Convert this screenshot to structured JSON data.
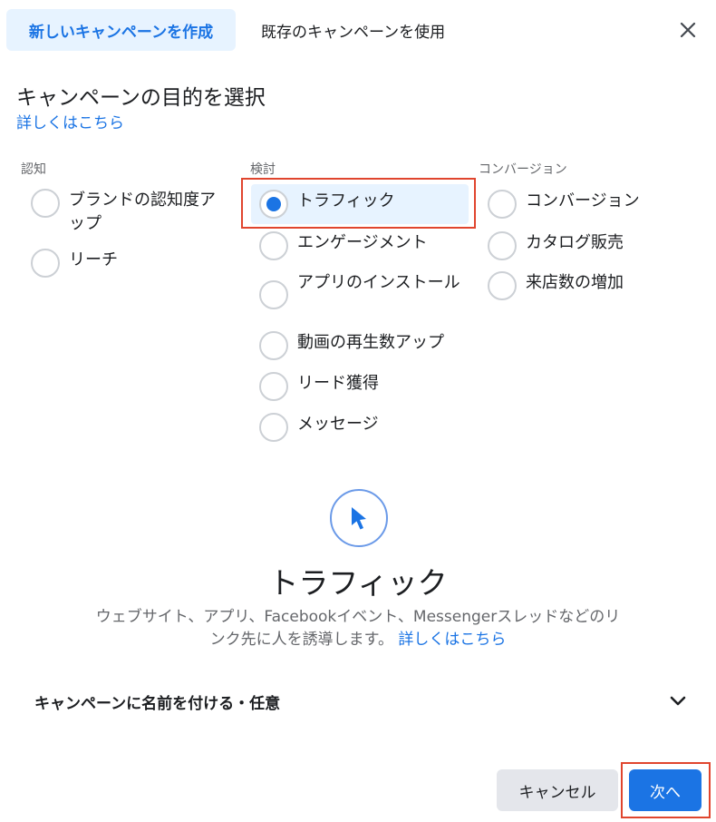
{
  "tabs": {
    "create_new": "新しいキャンペーンを作成",
    "use_existing": "既存のキャンペーンを使用"
  },
  "heading": "キャンペーンの目的を選択",
  "learn_more": "詳しくはこちら",
  "columns": [
    {
      "header": "認知",
      "options": [
        {
          "label": "ブランドの認知度アップ",
          "checked": false
        },
        {
          "label": "リーチ",
          "checked": false
        }
      ]
    },
    {
      "header": "検討",
      "options": [
        {
          "label": "トラフィック",
          "checked": true
        },
        {
          "label": "エンゲージメント",
          "checked": false
        },
        {
          "label": "アプリのインストール",
          "checked": false
        },
        {
          "label": "動画の再生数アップ",
          "checked": false
        },
        {
          "label": "リード獲得",
          "checked": false
        },
        {
          "label": "メッセージ",
          "checked": false
        }
      ]
    },
    {
      "header": "コンバージョン",
      "options": [
        {
          "label": "コンバージョン",
          "checked": false
        },
        {
          "label": "カタログ販売",
          "checked": false
        },
        {
          "label": "来店数の増加",
          "checked": false
        }
      ]
    }
  ],
  "objective": {
    "icon": "cursor-icon",
    "title": "トラフィック",
    "description": "ウェブサイト、アプリ、Facebookイベント、Messengerスレッドなどのリンク先に人を誘導します。",
    "link": "詳しくはこちら"
  },
  "campaign_name": {
    "label": "キャンペーンに名前を付ける・任意"
  },
  "buttons": {
    "cancel": "キャンセル",
    "next": "次へ"
  },
  "colors": {
    "accent": "#1b74e4",
    "highlight": "#e0452e",
    "selected_bg": "#e7f3ff"
  }
}
